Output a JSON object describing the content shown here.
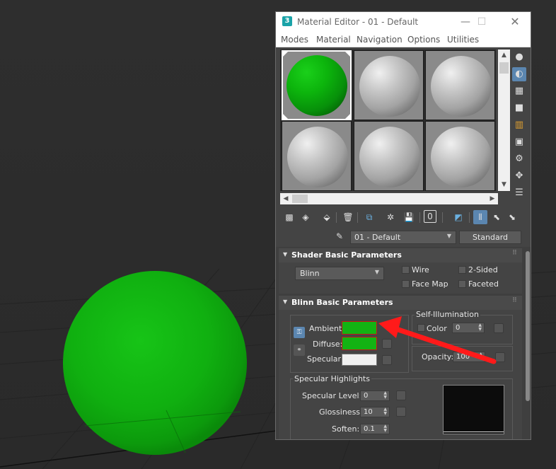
{
  "window": {
    "app_icon": "3",
    "title": "Material Editor - 01 - Default",
    "minimize": "—",
    "maximize": "☐",
    "close": "✕"
  },
  "menu": [
    "Modes",
    "Material",
    "Navigation",
    "Options",
    "Utilities"
  ],
  "slots": [
    {
      "color": "green",
      "active": true
    },
    {
      "color": "gray",
      "active": false
    },
    {
      "color": "gray",
      "active": false
    },
    {
      "color": "gray",
      "active": false
    },
    {
      "color": "gray",
      "active": false
    },
    {
      "color": "gray",
      "active": false
    }
  ],
  "side_tools": [
    {
      "name": "sample-type-icon",
      "glyph": "●"
    },
    {
      "name": "backlight-icon",
      "glyph": "◐",
      "selected": true
    },
    {
      "name": "background-icon",
      "glyph": "▦"
    },
    {
      "name": "sample-uv-tiling-icon",
      "glyph": "■"
    },
    {
      "name": "video-color-check-icon",
      "glyph": "▥"
    },
    {
      "name": "make-preview-icon",
      "glyph": "▣"
    },
    {
      "name": "options-icon",
      "glyph": "⚙"
    },
    {
      "name": "select-by-material-icon",
      "glyph": "✥"
    },
    {
      "name": "material-map-navigator-icon",
      "glyph": "☰"
    }
  ],
  "toolbar": [
    {
      "name": "get-material-icon",
      "glyph": "▩"
    },
    {
      "name": "put-material-to-scene-icon",
      "glyph": "◈"
    },
    {
      "name": "assign-material-icon",
      "glyph": "⬙"
    },
    {
      "name": "reset-map-icon",
      "glyph": "🗑"
    },
    {
      "name": "make-material-copy-icon",
      "glyph": "⧉"
    },
    {
      "name": "make-unique-icon",
      "glyph": "✲"
    },
    {
      "name": "put-to-library-icon",
      "glyph": "💾"
    },
    {
      "name": "material-id-channel-icon",
      "glyph": "0"
    },
    {
      "name": "show-shaded-material-icon",
      "glyph": "◩"
    },
    {
      "name": "show-end-result-icon",
      "glyph": "⫴"
    },
    {
      "name": "go-to-parent-icon",
      "glyph": "⬉"
    },
    {
      "name": "go-forward-to-sibling-icon",
      "glyph": "⬊"
    }
  ],
  "material_name": "01 - Default",
  "material_type": "Standard",
  "shader": {
    "title": "Shader Basic Parameters",
    "type": "Blinn",
    "options": {
      "wire": "Wire",
      "two_sided": "2-Sided",
      "face_map": "Face Map",
      "faceted": "Faceted"
    }
  },
  "blinn": {
    "title": "Blinn Basic Parameters",
    "ambient_label": "Ambient:",
    "diffuse_label": "Diffuse:",
    "specular_label": "Specular:",
    "ambient_color": "#13b313",
    "diffuse_color": "#13b313",
    "specular_color": "#f0f0f0",
    "lock_icon": "⚿",
    "self_illum_title": "Self-Illumination",
    "color_label": "Color",
    "color_value": "0",
    "opacity_label": "Opacity:",
    "opacity_value": "100",
    "highlights_title": "Specular Highlights",
    "spec_level_label": "Specular Level:",
    "spec_level_value": "0",
    "glossiness_label": "Glossiness:",
    "glossiness_value": "10",
    "soften_label": "Soften:",
    "soften_value": "0.1"
  },
  "colors": {
    "scene_sphere": "#12b612",
    "annotation_arrow": "#ff1a1a"
  }
}
